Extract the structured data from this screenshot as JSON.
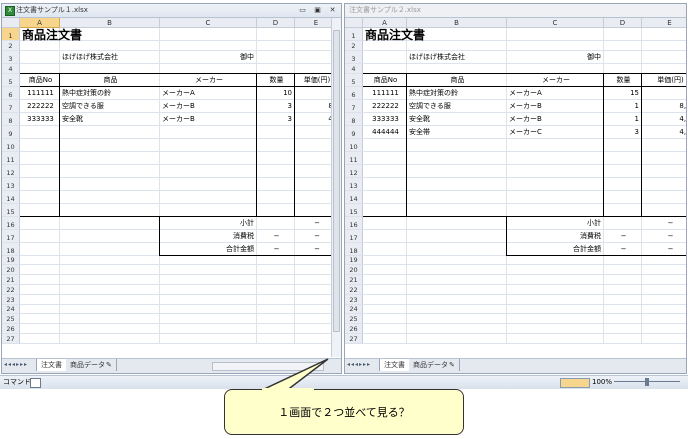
{
  "windows": [
    {
      "title": "注文書サンプル１.xlsx",
      "columns": [
        "A",
        "B",
        "C",
        "D",
        "E"
      ],
      "rows": [
        "1",
        "2",
        "3",
        "4",
        "5",
        "6",
        "7",
        "8",
        "9",
        "10",
        "11",
        "12",
        "13",
        "14",
        "15",
        "16",
        "17",
        "18",
        "19",
        "20",
        "21",
        "22",
        "23",
        "24",
        "25",
        "26",
        "27"
      ],
      "doc_title": "商品注文書",
      "customer": "ほげほげ株式会社",
      "honorific": "御中",
      "headers": [
        "商品No",
        "商品",
        "メーカー",
        "数量",
        "単価(円)"
      ],
      "items": [
        {
          "no": "111111",
          "name": "熱中症対策の鈴",
          "maker": "メーカーA",
          "qty": "10",
          "price": ""
        },
        {
          "no": "222222",
          "name": "空調できる服",
          "maker": "メーカーB",
          "qty": "3",
          "price": "8,"
        },
        {
          "no": "333333",
          "name": "安全靴",
          "maker": "メーカーB",
          "qty": "3",
          "price": "4,"
        }
      ],
      "totals": [
        {
          "label": "小計",
          "tax": "",
          "value": "−"
        },
        {
          "label": "消費税",
          "tax": "−",
          "value": "−"
        },
        {
          "label": "合計金額",
          "tax": "−",
          "value": "−"
        }
      ],
      "tabs": [
        "注文書",
        "商品データ"
      ],
      "window_buttons": [
        "▭",
        "▣",
        "✕"
      ]
    },
    {
      "title": "注文書サンプル２.xlsx",
      "columns": [
        "A",
        "B",
        "C",
        "D",
        "E"
      ],
      "rows": [
        "1",
        "2",
        "3",
        "4",
        "5",
        "6",
        "7",
        "8",
        "9",
        "10",
        "11",
        "12",
        "13",
        "14",
        "15",
        "16",
        "17",
        "18",
        "19",
        "20",
        "21",
        "22",
        "23",
        "24",
        "25",
        "26",
        "27"
      ],
      "doc_title": "商品注文書",
      "date_partial": "20",
      "customer": "ほげほげ株式会社",
      "honorific": "御中",
      "headers": [
        "商品No",
        "商品",
        "メーカー",
        "数量",
        "単価(円)"
      ],
      "items": [
        {
          "no": "111111",
          "name": "熱中症対策の鈴",
          "maker": "メーカーA",
          "qty": "15",
          "price": "60"
        },
        {
          "no": "222222",
          "name": "空調できる服",
          "maker": "メーカーB",
          "qty": "1",
          "price": "8,90"
        },
        {
          "no": "333333",
          "name": "安全靴",
          "maker": "メーカーB",
          "qty": "1",
          "price": "4,80"
        },
        {
          "no": "444444",
          "name": "安全帯",
          "maker": "メーカーC",
          "qty": "3",
          "price": "4,50"
        }
      ],
      "totals": [
        {
          "label": "小計",
          "tax": "",
          "value": "−"
        },
        {
          "label": "消費税",
          "tax": "−",
          "value": "−"
        },
        {
          "label": "合計金額",
          "tax": "−",
          "value": "−"
        }
      ],
      "tabs": [
        "注文書",
        "商品データ"
      ]
    }
  ],
  "statusbar": {
    "mode": "コマンド",
    "zoom": "100%"
  },
  "callout": "１画面で２つ並べて見る？"
}
